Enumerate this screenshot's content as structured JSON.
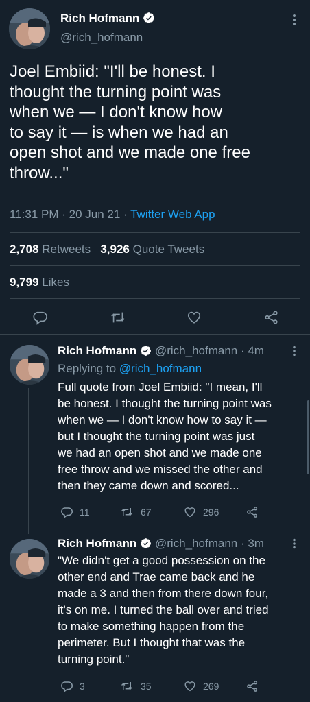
{
  "main_tweet": {
    "author_name": "Rich Hofmann",
    "author_handle": "@rich_hofmann",
    "text_lines": [
      "Joel Embiid: \"I'll be honest. I",
      "thought the turning point was",
      "when we — I don't know how",
      "to say it — is when we had an",
      "open shot and we made one free",
      "throw...\""
    ],
    "time": "11:31 PM · 20 Jun 21 · ",
    "client": "Twitter Web App",
    "retweets_count": "2,708",
    "retweets_label": "Retweets",
    "quotes_count": "3,926",
    "quotes_label": "Quote Tweets",
    "likes_count": "9,799",
    "likes_label": "Likes"
  },
  "replies": [
    {
      "author_name": "Rich Hofmann",
      "author_handle": "@rich_hofmann",
      "age": "· 4m",
      "replying_to_label": "Replying to ",
      "replying_to_handle": "@rich_hofmann",
      "text_lines": [
        "Full quote from Joel Embiid: \"I mean, I'll",
        "be honest. I thought the turning point was",
        "when we — I don't know how to say it —",
        "but I thought the turning point was just",
        "we had an open shot and we made one",
        "free throw and we missed the other and",
        "then they came down and scored..."
      ],
      "reply_count": "11",
      "retweet_count": "67",
      "like_count": "296"
    },
    {
      "author_name": "Rich Hofmann",
      "author_handle": "@rich_hofmann",
      "age": "· 3m",
      "text_lines": [
        "\"We didn't get a good possession on the",
        "other end and Trae came back and he",
        "made a 3 and then from there down four,",
        "it's on me. I turned the ball over and tried",
        "to make something happen from the",
        "perimeter. But I thought that was the",
        "turning point.\""
      ],
      "reply_count": "3",
      "retweet_count": "35",
      "like_count": "269"
    }
  ],
  "colors": {
    "background": "#15202b",
    "accent": "#1da1f2",
    "muted": "#8899a6",
    "divider": "#38444d"
  }
}
